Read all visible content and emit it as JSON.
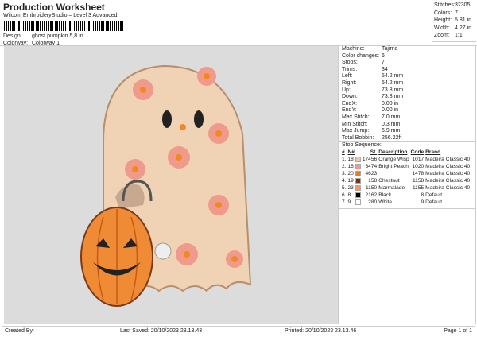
{
  "header": {
    "title": "Production Worksheet",
    "subtitle": "Wilcom EmbroideryStudio – Level 3 Advanced",
    "design_label": "Design:",
    "design": "ghost pumpkin 5,8 in",
    "colorway_label": "Colorway:",
    "colorway": "Colorway 1"
  },
  "summary": [
    {
      "label": "Stitches:",
      "value": "32305"
    },
    {
      "label": "Colors:",
      "value": "7"
    },
    {
      "label": "Height:",
      "value": "5.81 in"
    },
    {
      "label": "Width:",
      "value": "4.27 in"
    },
    {
      "label": "Zoom:",
      "value": "1:1"
    }
  ],
  "details": [
    {
      "label": "Machine:",
      "value": "Tajima"
    },
    {
      "label": "Color changes:",
      "value": "6"
    },
    {
      "label": "Stops:",
      "value": "7"
    },
    {
      "label": "Trims:",
      "value": "34"
    },
    {
      "label": "Left:",
      "value": "54.2 mm"
    },
    {
      "label": "Right:",
      "value": "54.2 mm"
    },
    {
      "label": "Up:",
      "value": "73.8 mm"
    },
    {
      "label": "Down:",
      "value": "73.8 mm"
    },
    {
      "label": "EndX:",
      "value": "0.00 in"
    },
    {
      "label": "EndY:",
      "value": "0.00 in"
    },
    {
      "label": "Max Stitch:",
      "value": "7.0 mm"
    },
    {
      "label": "Min Stitch:",
      "value": "0.3 mm"
    },
    {
      "label": "Max Jump:",
      "value": "6.9 mm"
    },
    {
      "label": "Total Bobbin:",
      "value": "256.22ft"
    }
  ],
  "stop_sequence": {
    "title": "Stop Sequence:",
    "headers": [
      "#",
      "N#",
      "St.",
      "Description",
      "Code",
      "Brand"
    ],
    "rows": [
      {
        "n": "1.",
        "needle": "18",
        "color": "#f5c3a5",
        "st": "17456",
        "desc": "Orange Wisp",
        "code": "1017",
        "brand": "Madeira Classic 40"
      },
      {
        "n": "2.",
        "needle": "16",
        "color": "#f29a88",
        "st": "6474",
        "desc": "Bright Peach",
        "code": "1020",
        "brand": "Madeira Classic 40"
      },
      {
        "n": "3.",
        "needle": "20",
        "color": "#f07a1a",
        "st": "4623",
        "desc": "",
        "code": "1478",
        "brand": "Madeira Classic 40"
      },
      {
        "n": "4.",
        "needle": "19",
        "color": "#6e3420",
        "st": "158",
        "desc": "Chestnut",
        "code": "1158",
        "brand": "Madeira Classic 40"
      },
      {
        "n": "5.",
        "needle": "23",
        "color": "#f39a5a",
        "st": "1150",
        "desc": "Marmalade",
        "code": "1155",
        "brand": "Madeira Classic 40"
      },
      {
        "n": "6.",
        "needle": "8",
        "color": "#000000",
        "st": "2162",
        "desc": "Black",
        "code": "8",
        "brand": "Default"
      },
      {
        "n": "7.",
        "needle": "9",
        "color": "#ffffff",
        "st": "280",
        "desc": "White",
        "code": "9",
        "brand": "Default"
      }
    ]
  },
  "footer": {
    "created_by": "Created By:",
    "last_saved": "Last Saved: 20/10/2023 23.13.43",
    "printed": "Printed: 20/10/2023 23.13.46",
    "page": "Page 1 of 1"
  }
}
